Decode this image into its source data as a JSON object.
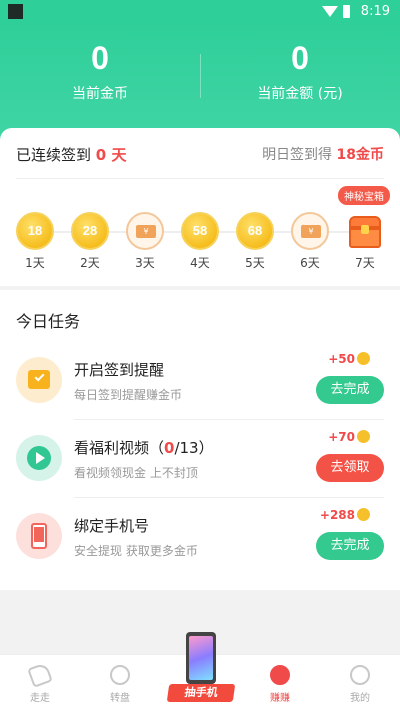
{
  "status_bar": {
    "time": "8:19"
  },
  "header": {
    "coins_value": "0",
    "coins_label": "当前金币",
    "amount_value": "0",
    "amount_label": "当前金额 (元)"
  },
  "signin": {
    "streak_prefix": "已连续签到",
    "streak_value": "0 天",
    "tomorrow_prefix": "明日签到得",
    "tomorrow_value": "18金币",
    "mystery_badge": "神秘宝箱",
    "days": [
      {
        "reward": "18",
        "type": "coin",
        "label": "1天"
      },
      {
        "reward": "28",
        "type": "coin",
        "label": "2天"
      },
      {
        "reward": "¥",
        "type": "coupon",
        "label": "3天"
      },
      {
        "reward": "58",
        "type": "coin",
        "label": "4天"
      },
      {
        "reward": "68",
        "type": "coin",
        "label": "5天"
      },
      {
        "reward": "¥",
        "type": "coupon",
        "label": "6天"
      },
      {
        "reward": "",
        "type": "chest",
        "label": "7天"
      }
    ]
  },
  "tasks": {
    "title": "今日任务",
    "items": [
      {
        "name": "开启签到提醒",
        "progress_current": "",
        "progress_total": "",
        "desc": "每日签到提醒赚金币",
        "reward": "+50",
        "button": "去完成",
        "icon": "calendar-check-icon"
      },
      {
        "name": "看福利视频（",
        "progress_current": "0",
        "progress_total": "/13）",
        "desc": "看视频领现金 上不封顶",
        "reward": "+70",
        "button": "去领取",
        "icon": "play-icon"
      },
      {
        "name": "绑定手机号",
        "progress_current": "",
        "progress_total": "",
        "desc": "安全提现 获取更多金币",
        "reward": "+288",
        "button": "去完成",
        "icon": "phone-icon"
      }
    ]
  },
  "tabbar": {
    "walk": "走走",
    "wheel": "转盘",
    "promo": "抽手机",
    "earn": "赚赚",
    "mine": "我的"
  },
  "colors": {
    "primary": "#2fcf9a",
    "accent_red": "#f04a4a",
    "coin": "#f6be1e"
  }
}
